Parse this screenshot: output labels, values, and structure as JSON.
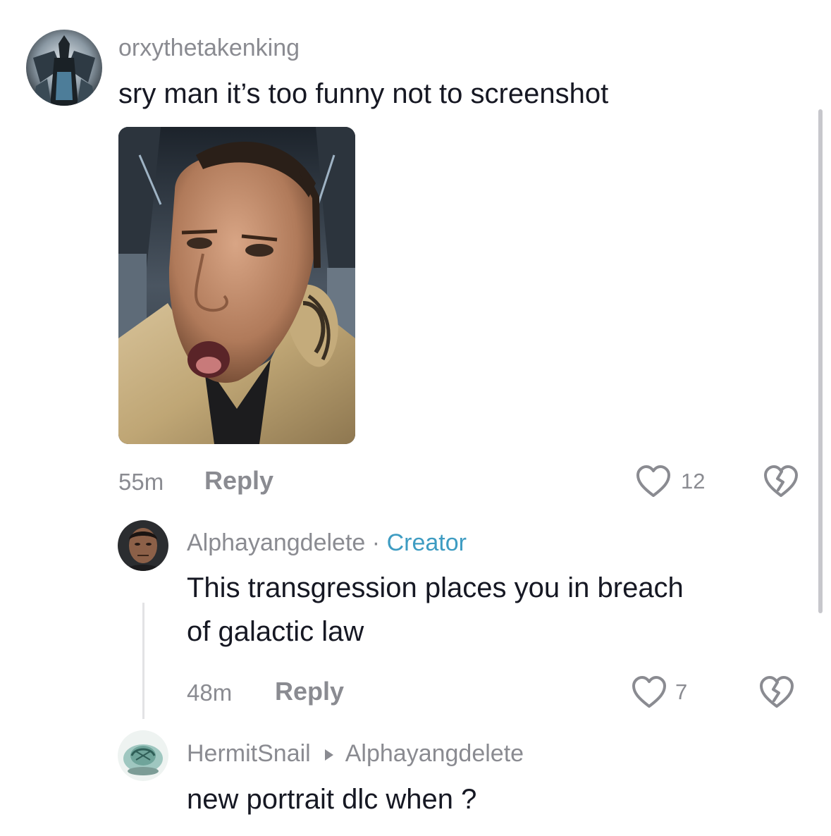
{
  "comments": [
    {
      "username": "orxythetakenking",
      "text": "sry man it’s too funny not to screenshot",
      "time": "55m",
      "reply_label": "Reply",
      "likes": "12"
    },
    {
      "username": "Alphayangdelete",
      "separator": "·",
      "badge": "Creator",
      "text_line1": "This transgression places you in breach",
      "text_line2": "of galactic law",
      "time": "48m",
      "reply_label": "Reply",
      "likes": "7"
    },
    {
      "username": "HermitSnail",
      "reply_to": "Alphayangdelete",
      "text": "new portrait dlc when ?"
    }
  ],
  "icons": {
    "like": "heart-outline-icon",
    "dislike": "broken-heart-icon",
    "reply_to": "triangle-right-icon"
  },
  "colors": {
    "creator_badge": "#3e9cc2",
    "muted_text": "#8a8b91",
    "primary_text": "#161823"
  }
}
